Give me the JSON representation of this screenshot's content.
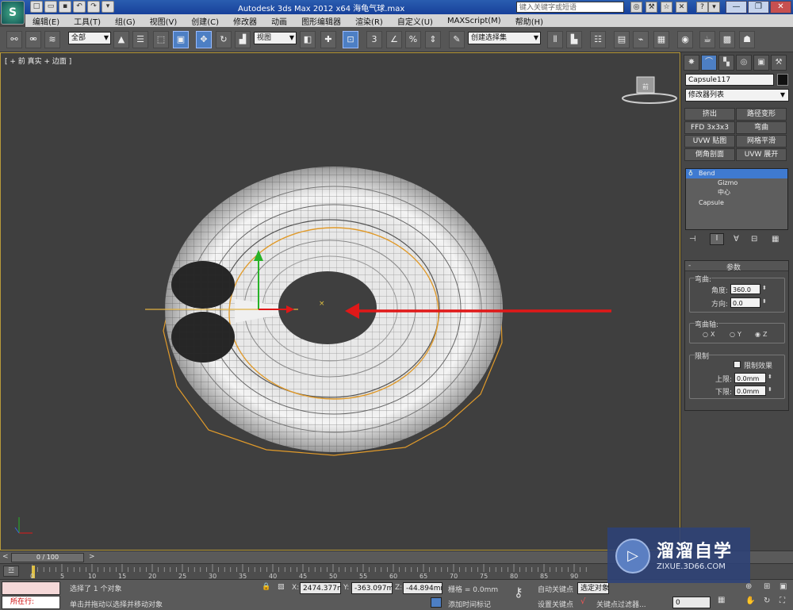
{
  "app": {
    "title": "Autodesk 3ds Max  2012 x64      海龟气球.max",
    "logo": "S",
    "search_placeholder": "键入关键字或短语"
  },
  "menu": [
    "编辑(E)",
    "工具(T)",
    "组(G)",
    "视图(V)",
    "创建(C)",
    "修改器",
    "动画",
    "图形编辑器",
    "渲染(R)",
    "自定义(U)",
    "MAXScript(M)",
    "帮助(H)"
  ],
  "toolbar": {
    "selection_filter": "全部",
    "reference_coord": "视图",
    "named_selection": "创建选择集"
  },
  "viewport": {
    "label": "[ + 前 真实 + 边面 ]",
    "viewcube": "前"
  },
  "command_panel": {
    "object_name": "Capsule117",
    "modifier_list": "修改器列表",
    "modifier_buttons": [
      "挤出",
      "路径变形",
      "FFD 3x3x3",
      "弯曲",
      "UVW 贴图",
      "网格平滑",
      "倒角剖面",
      "UVW 展开"
    ],
    "stack": [
      {
        "label": "Bend",
        "selected": true
      },
      {
        "label": "Gizmo",
        "selected": false
      },
      {
        "label": "中心",
        "selected": false
      },
      {
        "label": "Capsule",
        "selected": false
      }
    ],
    "params": {
      "rollout_title": "参数",
      "bend_group": "弯曲:",
      "angle_label": "角度:",
      "angle_value": "360.0",
      "direction_label": "方向:",
      "direction_value": "0.0",
      "axis_group": "弯曲轴:",
      "axis_x": "X",
      "axis_y": "Y",
      "axis_z": "Z",
      "selected_axis": "Z",
      "limits_group": "限制",
      "limit_effect": "限制效果",
      "upper_label": "上限:",
      "upper_value": "0.0mm",
      "lower_label": "下限:",
      "lower_value": "0.0mm"
    }
  },
  "timeline": {
    "frame": "0 / 100",
    "ticks": [
      "0",
      "5",
      "10",
      "15",
      "20",
      "25",
      "30",
      "35",
      "40",
      "45",
      "50",
      "55",
      "60",
      "65",
      "70",
      "75",
      "80",
      "85",
      "90"
    ]
  },
  "status": {
    "mode": "所在行:",
    "selection_info": "选择了 1 个对象",
    "prompt": "单击并拖动以选择并移动对象",
    "x_label": "X:",
    "x_value": "2474.377m",
    "y_label": "Y:",
    "y_value": "-363.097m",
    "z_label": "Z:",
    "z_value": "-44.894mm",
    "grid": "栅格 = 0.0mm",
    "add_time_tag": "添加时间标记",
    "auto_key": "自动关键点",
    "set_key": "设置关键点",
    "selected_set": "选定对象",
    "key_filters": "关键点过滤器...",
    "frame_field": "0"
  },
  "watermark": {
    "title": "溜溜自学",
    "subtitle": "ZIXUE.3D66.COM"
  },
  "colors": {
    "title_bar": "#1f4fa6",
    "selection_orange": "#e09a2a",
    "arrow_red": "#e01818",
    "stack_selected": "#3f7ad0"
  }
}
